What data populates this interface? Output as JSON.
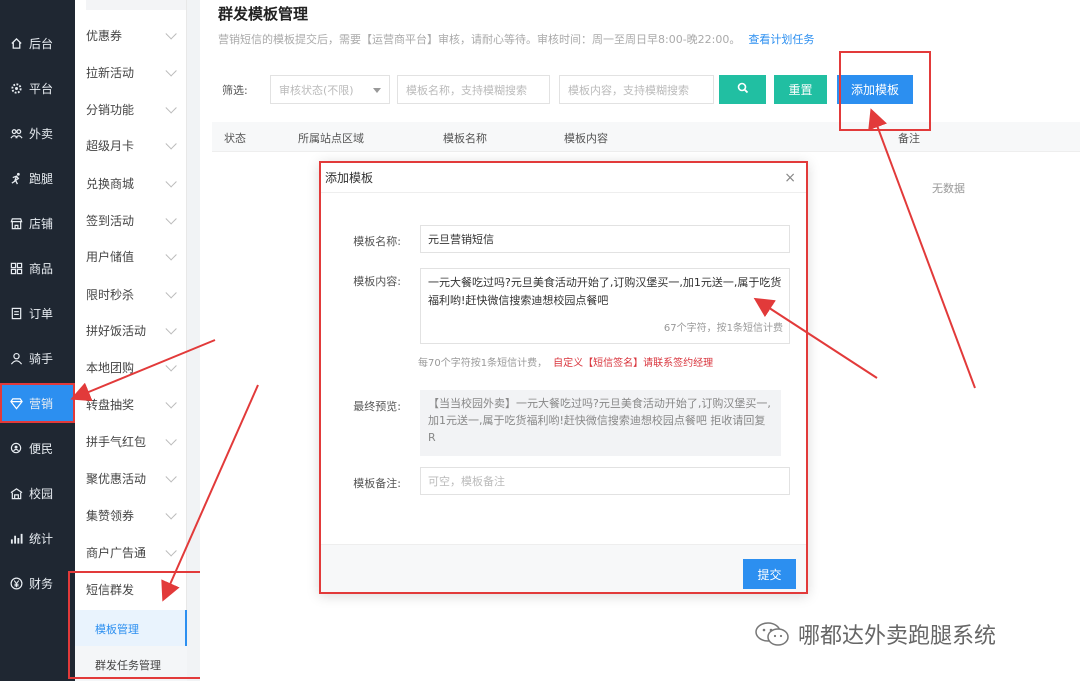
{
  "nav": {
    "items": [
      {
        "label": "后台",
        "icon": "home-icon"
      },
      {
        "label": "平台",
        "icon": "gear-icon"
      },
      {
        "label": "外卖",
        "icon": "group-icon"
      },
      {
        "label": "跑腿",
        "icon": "runner-icon"
      },
      {
        "label": "店铺",
        "icon": "store-icon"
      },
      {
        "label": "商品",
        "icon": "grid-icon"
      },
      {
        "label": "订单",
        "icon": "order-icon"
      },
      {
        "label": "骑手",
        "icon": "user-icon"
      },
      {
        "label": "营销",
        "icon": "diamond-icon"
      },
      {
        "label": "便民",
        "icon": "search-user-icon"
      },
      {
        "label": "校园",
        "icon": "campus-icon"
      },
      {
        "label": "统计",
        "icon": "chart-icon"
      },
      {
        "label": "财务",
        "icon": "yen-icon"
      }
    ]
  },
  "submenu": {
    "items": [
      "优惠券",
      "拉新活动",
      "分销功能",
      "超级月卡",
      "兑换商城",
      "签到活动",
      "用户储值",
      "限时秒杀",
      "拼好饭活动",
      "本地团购",
      "转盘抽奖",
      "拼手气红包",
      "聚优惠活动",
      "集赞领券",
      "商户广告通",
      "短信群发"
    ],
    "children": [
      "模板管理",
      "群发任务管理"
    ]
  },
  "page": {
    "title": "群发模板管理",
    "notice": "营销短信的模板提交后，需要【运营商平台】审核，请耐心等待。审核时间：周一至周日早8:00-晚22:00。",
    "notice_link": "查看计划任务"
  },
  "filter": {
    "label": "筛选:",
    "status_placeholder": "审核状态(不限)",
    "name_placeholder": "模板名称，支持模糊搜索",
    "content_placeholder": "模板内容，支持模糊搜索",
    "reset": "重置",
    "add": "添加模板"
  },
  "table": {
    "headers": [
      "状态",
      "所属站点区域",
      "模板名称",
      "模板内容",
      "备注"
    ],
    "empty": "无数据"
  },
  "modal": {
    "title": "添加模板",
    "close": "×",
    "name_label": "模板名称:",
    "name_value": "元旦营销短信",
    "content_label": "模板内容:",
    "content_value": "一元大餐吃过吗?元旦美食活动开始了,订购汉堡买一,加1元送一,属于吃货福利哟!赶快微信搜索迪想校园点餐吧",
    "count": "67个字符，按1条短信计费",
    "hint": "每70个字符按1条短信计费，",
    "hint_warn": "自定义【短信签名】请联系签约经理",
    "preview_label": "最终预览:",
    "preview_value": "【当当校园外卖】一元大餐吃过吗?元旦美食活动开始了,订购汉堡买一,加1元送一,属于吃货福利哟!赶快微信搜索迪想校园点餐吧 拒收请回复R",
    "remark_label": "模板备注:",
    "remark_placeholder": "可空，模板备注",
    "submit": "提交"
  },
  "watermark": "哪都达外卖跑腿系统",
  "colors": {
    "nav_bg": "#1f2732",
    "accent": "#2c8ff0",
    "green": "#21bfa2",
    "annotation": "#e23a3a"
  }
}
